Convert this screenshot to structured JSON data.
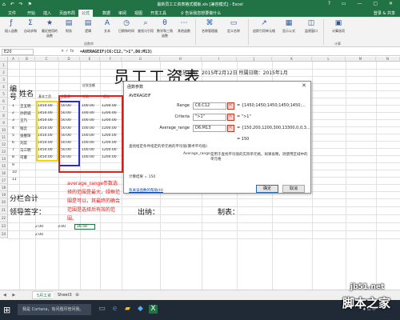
{
  "window": {
    "title": "最新员工工资表格式模板.xls [兼容模式] - Excel",
    "qat": "⌂ ↶ ↷ ⚑",
    "controls": "? ▭ — ▢ ✕"
  },
  "tabs": {
    "file": "文件",
    "home": "开始",
    "insert": "插入",
    "layout": "页面布局",
    "formulas": "公式",
    "data": "数据",
    "review": "审阅",
    "view": "视图",
    "developer": "开发工具",
    "tell": "♀ 告诉我您想要做什么",
    "login": "登录 & 共享"
  },
  "ribbon": {
    "insert_function": "插入函数",
    "autosum": "自动求和",
    "recent": "最近使用的函数",
    "financial": "财务",
    "logical": "逻辑",
    "text": "文本",
    "datetime": "日期和时间",
    "lookup": "查找与引用",
    "math": "数学和三角函数",
    "more": "其他函数",
    "group_library": "函数库",
    "name_manager": "名称管理器",
    "define_name": "定义名称",
    "trace": "追踪引用单元格",
    "show_formulas": "显示公式",
    "watch": "监视窗口",
    "calc_options": "计算选项",
    "group_calc": "计算"
  },
  "formula_bar": {
    "name_box": "E20",
    "fx": "× ✓ fx",
    "formula": "=AVERAGEIF(C6:C12,\">1\",D6:M13)"
  },
  "columns": [
    "A",
    "B",
    "C",
    "D",
    "E",
    "F",
    "G",
    "H",
    "I",
    "J",
    "K",
    "L",
    "M",
    "N"
  ],
  "rows": [
    "1",
    "2",
    "3",
    "4",
    "5",
    "6",
    "7",
    "8",
    "9",
    "10",
    "11",
    "12",
    "13",
    "14",
    "15",
    "16",
    "17",
    "18",
    "19",
    "20",
    "21",
    "22",
    "23",
    "24"
  ],
  "sheet": {
    "title": "员工工资表",
    "subtitle": "发放日期：2015年2月12日 所属日期：2015年1月",
    "header_num": "编号",
    "header_name": "姓名",
    "header_should": "应发金额",
    "header_base": "基本工资",
    "header_full": "全勤奖",
    "header_overtime": "补助",
    "header_perf": "绩效",
    "numbers": [
      "1",
      "2",
      "3",
      "4",
      "5",
      "6",
      "7",
      "8",
      "9",
      "10",
      "11"
    ],
    "names": [
      "王五明",
      "孙新诚",
      "王乃",
      "钱云",
      "张璧琛",
      "刘蕊",
      "马三明",
      "司睿"
    ],
    "base": [
      "1450.00",
      "1450.00",
      "1450.00",
      "1450.00",
      "1450.00",
      "1450.00",
      "1450.00",
      "1450.00"
    ],
    "full": [
      "50.00",
      "50.00",
      "50.00",
      "50.00",
      "50.00",
      "50.00",
      "50.00",
      "50.00"
    ],
    "overtime": [
      "100.00",
      "100.00",
      "100.00",
      "100.00",
      "100.00",
      "100.00",
      "100.00",
      "100.00"
    ],
    "perf": [
      "1200.00",
      "1200.00",
      "1200.00",
      "1200.00",
      "1200.00",
      "1200.00",
      "1200.00",
      "1200.00"
    ],
    "subtotal": "分栏合计",
    "leader": "领导签字：",
    "cashier": "出纳：",
    "maker": "制表：",
    "r20a": "2.00",
    "r20b": "3.00",
    "r20e": "16.50",
    "r21a": "2.00"
  },
  "annotation": "average_range参数选择的范围是最大，绿框范围是可以，其最终的确会范围是选择后有效的范围。",
  "dialog": {
    "title": "函数参数",
    "close": "✕",
    "function": "AVERAGEIF",
    "range_label": "Range",
    "range_value": "C6:C12",
    "range_result": "= {1450;1450;1450;1450;1450;...",
    "criteria_label": "Criteria",
    "criteria_value": "\">1\"",
    "criteria_result": "= \">1\"",
    "avg_label": "Average_range",
    "avg_value": "D6:M13",
    "avg_result": "= {150,200,1200,300,13300,0,0,3...",
    "total": "= 150",
    "desc": "查找给定条件指定的单元格的平均值(算术平均值)",
    "avg_desc_label": "Average_range",
    "avg_desc": "是用于查找平均值的实际单元格。如果省略，则使用区域中的单元格",
    "calc_result": "计算结果 = 150",
    "help": "有关该函数的帮助(H)",
    "ok": "确定",
    "cancel": "取消"
  },
  "sheet_tabs": {
    "nav": "◀ ▶",
    "tab1": "5月工资",
    "tab2": "Sheet3",
    "add": "⊕"
  },
  "taskbar": {
    "start": "⊞",
    "search": "我是 Cortana，有问题尽管问我。",
    "tray": "^ ♦ ⊡ 中"
  },
  "watermark": {
    "site": "jb51.net",
    "brand": "脚本之家"
  },
  "colors": {
    "excel_green": "#217346",
    "yellow_box": "#f3d800",
    "blue_box": "#2b2bd6",
    "red_box": "#e0201c"
  }
}
